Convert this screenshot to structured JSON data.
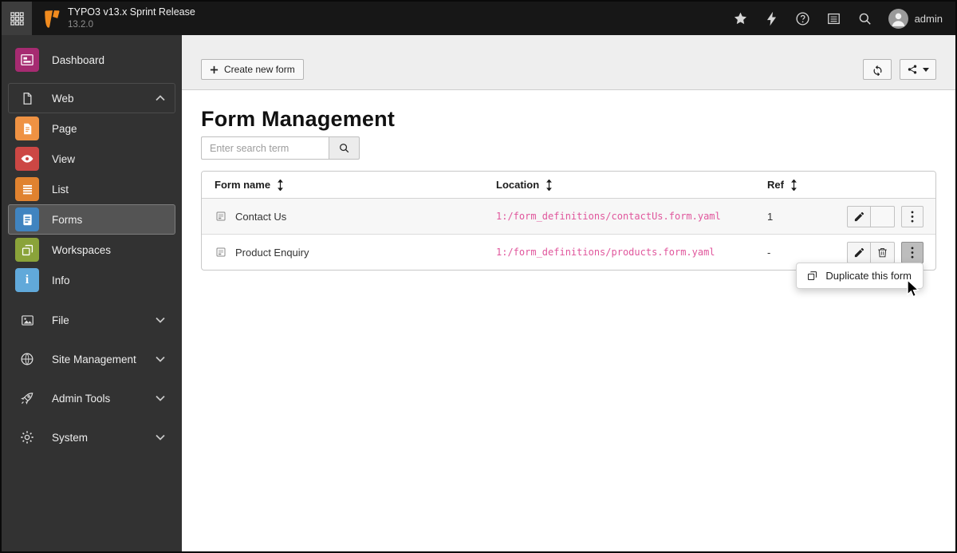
{
  "topbar": {
    "title": "TYPO3 v13.x Sprint Release",
    "version": "13.2.0",
    "username": "admin"
  },
  "sidebar": {
    "items": [
      {
        "label": "Dashboard",
        "type": "module",
        "color": "#a62b71"
      },
      {
        "label": "Web",
        "type": "group-expanded"
      },
      {
        "label": "Page",
        "type": "module",
        "color": "#ef9243"
      },
      {
        "label": "View",
        "type": "module",
        "color": "#cc4744"
      },
      {
        "label": "List",
        "type": "module",
        "color": "#e0822f"
      },
      {
        "label": "Forms",
        "type": "module",
        "color": "#4084c0",
        "active": true
      },
      {
        "label": "Workspaces",
        "type": "module",
        "color": "#8aa33a"
      },
      {
        "label": "Info",
        "type": "module",
        "color": "#61a9da"
      },
      {
        "label": "File",
        "type": "group-collapsed"
      },
      {
        "label": "Site Management",
        "type": "group-collapsed"
      },
      {
        "label": "Admin Tools",
        "type": "group-collapsed"
      },
      {
        "label": "System",
        "type": "group-collapsed"
      }
    ]
  },
  "docheader": {
    "create_button": "Create new form"
  },
  "main": {
    "title": "Form Management"
  },
  "search": {
    "placeholder": "Enter search term",
    "value": ""
  },
  "table": {
    "headers": {
      "name": "Form name",
      "location": "Location",
      "ref": "Ref"
    },
    "rows": [
      {
        "name": "Contact Us",
        "location": "1:/form_definitions/contactUs.form.yaml",
        "ref": "1",
        "deletable": false,
        "menu_open": false
      },
      {
        "name": "Product Enquiry",
        "location": "1:/form_definitions/products.form.yaml",
        "ref": "-",
        "deletable": true,
        "menu_open": true
      }
    ]
  },
  "context_menu": {
    "items": [
      {
        "label": "Duplicate this form"
      }
    ]
  },
  "icons": {
    "menu-grid": "▦",
    "typo3-logo": "V",
    "star": "★",
    "bolt": "⚡",
    "help": "?",
    "opendocs": "☰",
    "search": "🔍",
    "avatar": "👤",
    "chevron-up": "^",
    "chevron-down": "v",
    "plus": "+",
    "refresh": "⟳",
    "share": "⋘",
    "caret-down": "▾",
    "sort": "↕",
    "form-page": "▤",
    "edit": "✎",
    "delete": "🗑",
    "more-vertical": "⋮",
    "duplicate": "⧉",
    "cursor": "➤",
    "dashboard": "▦",
    "document": "📄",
    "eye": "👁",
    "list": "☰",
    "workspaces": "⧉",
    "info": "i",
    "image": "🖼",
    "globe": "🌐",
    "rocket": "🚀",
    "gear": "⚙"
  },
  "colors": {
    "topbar_bg": "#171717",
    "sidebar_bg": "#323232",
    "docheader_bg": "#eeeeee",
    "brand_orange": "#f08b1f",
    "location_link": "#e0569c",
    "active_item_bg": "#545454",
    "table_stripe": "#f7f7f7",
    "pressed_button": "#bdbdbd"
  }
}
